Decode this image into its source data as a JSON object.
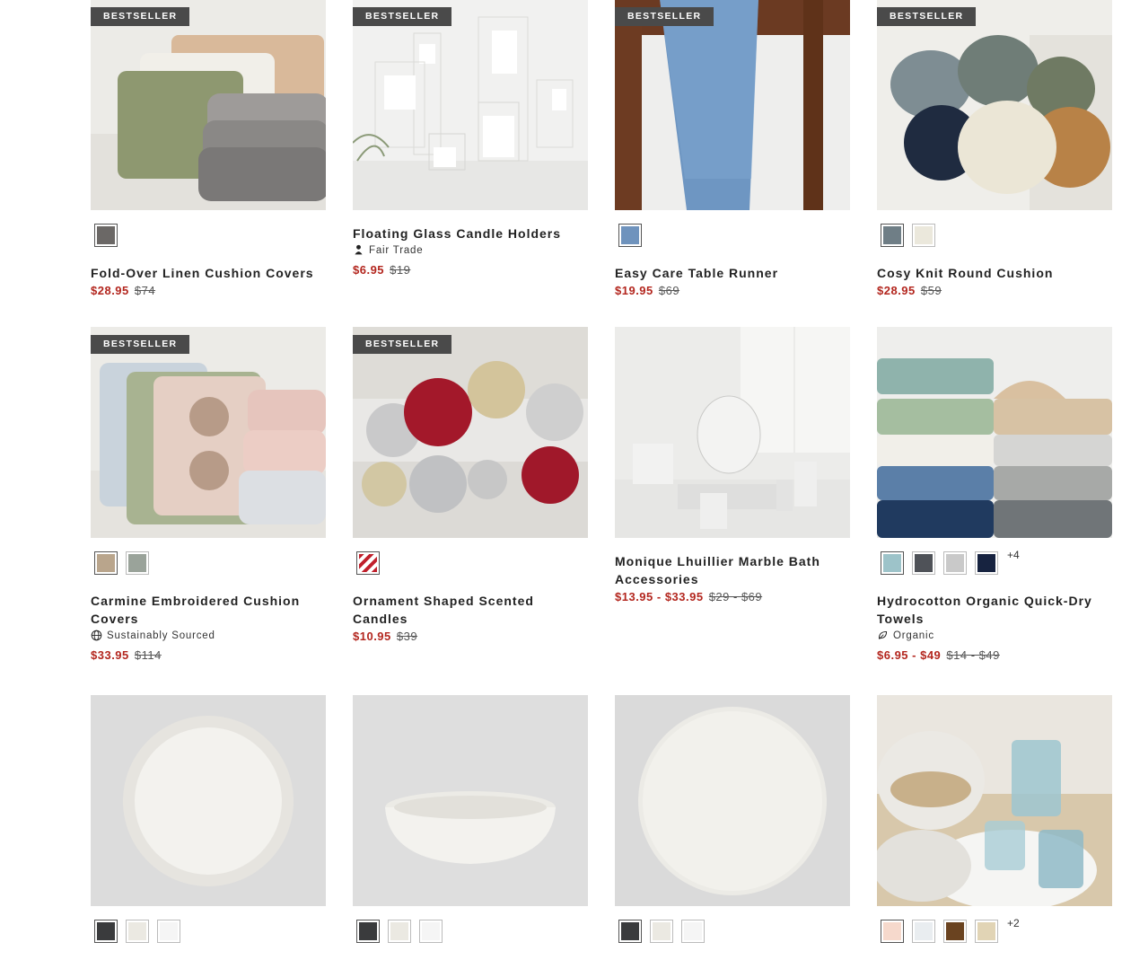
{
  "badge_label": "BESTSELLER",
  "products": [
    {
      "name": "Fold-Over Linen Cushion Covers",
      "bestseller": true,
      "swatches": [
        "#6b6866"
      ],
      "sale": "$28.95",
      "orig": "$74",
      "scene": "cushions"
    },
    {
      "name": "Floating Glass Candle Holders",
      "bestseller": true,
      "swatches": [],
      "tag": "Fair Trade",
      "tag_icon": "fair-trade-icon",
      "sale": "$6.95",
      "orig": "$19",
      "scene": "glass"
    },
    {
      "name": "Easy Care Table Runner",
      "bestseller": true,
      "swatches": [
        "#6f93bd"
      ],
      "sale": "$19.95",
      "orig": "$69",
      "scene": "runner"
    },
    {
      "name": "Cosy Knit Round Cushion",
      "bestseller": true,
      "swatches": [
        "#6f7e86",
        "#ebe8dc"
      ],
      "sale": "$28.95",
      "orig": "$59",
      "scene": "knit"
    },
    {
      "name": "Carmine Embroidered Cushion Covers",
      "bestseller": true,
      "swatches": [
        "#b9a58c",
        "#9aa39a"
      ],
      "tag": "Sustainably Sourced",
      "tag_icon": "globe-icon",
      "sale": "$33.95",
      "orig": "$114",
      "scene": "embroidered"
    },
    {
      "name": "Ornament Shaped Scented Candles",
      "bestseller": true,
      "swatches": [
        "stripe"
      ],
      "sale": "$10.95",
      "orig": "$39",
      "scene": "ornaments"
    },
    {
      "name": "Monique Lhuillier Marble Bath Accessories",
      "bestseller": false,
      "swatches": [],
      "sale": "$13.95 - $33.95",
      "orig": "$29 - $69",
      "scene": "bath"
    },
    {
      "name": "Hydrocotton Organic Quick-Dry Towels",
      "bestseller": false,
      "swatches": [
        "#9dc3c9",
        "#4f5258",
        "#c9c9c9",
        "#172340"
      ],
      "more": "+4",
      "tag": "Organic",
      "tag_icon": "leaf-icon",
      "sale": "$6.95 - $49",
      "orig": "$14 - $49",
      "scene": "towels"
    },
    {
      "name": "",
      "bestseller": false,
      "swatches": [
        "#3a3b3d",
        "#ebe9e2",
        "#f5f5f5"
      ],
      "scene": "plate-rim"
    },
    {
      "name": "",
      "bestseller": false,
      "swatches": [
        "#3a3b3d",
        "#ebe9e2",
        "#f5f5f5"
      ],
      "scene": "bowl"
    },
    {
      "name": "",
      "bestseller": false,
      "swatches": [
        "#3a3b3d",
        "#ebe9e2",
        "#f5f5f5"
      ],
      "scene": "plate"
    },
    {
      "name": "",
      "bestseller": false,
      "swatches": [
        "#f6d9cc",
        "#e9edf0",
        "#6a4320",
        "#e1d4b5"
      ],
      "more": "+2",
      "scene": "table"
    }
  ]
}
